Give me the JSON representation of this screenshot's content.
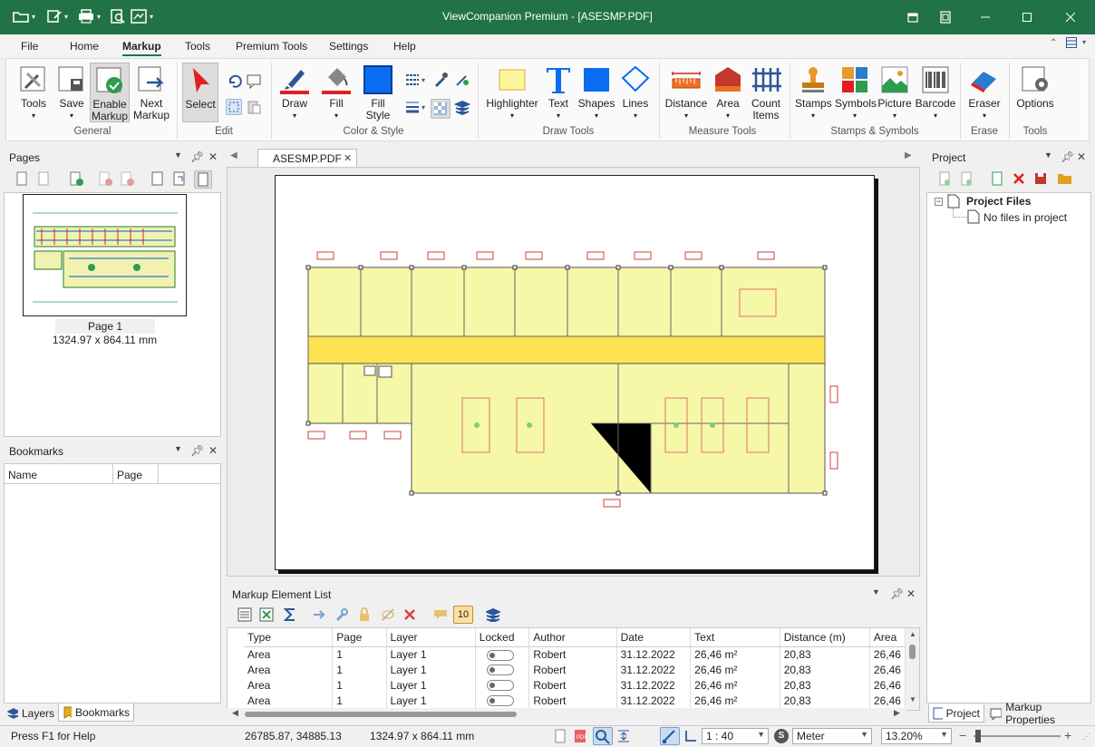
{
  "app": {
    "title": "ViewCompanion Premium - [ASESMP.PDF]",
    "accent": "#217346"
  },
  "menu": {
    "items": [
      "File",
      "Home",
      "Markup",
      "Tools",
      "Premium Tools",
      "Settings",
      "Help"
    ],
    "active": "Markup"
  },
  "ribbon": {
    "general": {
      "label": "General",
      "tools": "Tools",
      "save": "Save",
      "enable1": "Enable",
      "enable2": "Markup",
      "next1": "Next",
      "next2": "Markup"
    },
    "edit": {
      "label": "Edit",
      "select": "Select"
    },
    "color_style": {
      "label": "Color & Style",
      "draw": "Draw",
      "fill": "Fill",
      "fillstyle1": "Fill",
      "fillstyle2": "Style"
    },
    "draw_tools": {
      "label": "Draw Tools",
      "highlighter": "Highlighter",
      "text": "Text",
      "shapes": "Shapes",
      "lines": "Lines"
    },
    "measure_tools": {
      "label": "Measure Tools",
      "distance": "Distance",
      "area": "Area",
      "count1": "Count",
      "count2": "Items"
    },
    "stamps_symbols": {
      "label": "Stamps & Symbols",
      "stamps": "Stamps",
      "symbols": "Symbols",
      "picture": "Picture",
      "barcode": "Barcode"
    },
    "erase": {
      "label": "Erase",
      "eraser": "Eraser"
    },
    "tools": {
      "label": "Tools",
      "options": "Options"
    }
  },
  "pages_panel": {
    "title": "Pages",
    "page_label": "Page 1",
    "page_size": "1324.97 x 864.11 mm"
  },
  "bookmarks_panel": {
    "title": "Bookmarks",
    "col_name": "Name",
    "col_page": "Page"
  },
  "left_tabs": {
    "layers": "Layers",
    "bookmarks": "Bookmarks"
  },
  "document": {
    "tab": "ASESMP.PDF"
  },
  "project_panel": {
    "title": "Project",
    "root": "Project Files",
    "child": "No files in project"
  },
  "right_tabs": {
    "project": "Project",
    "markup_properties": "Markup Properties"
  },
  "markup_list": {
    "title": "Markup Element List",
    "badge": "10",
    "columns": [
      "Type",
      "Page",
      "Layer",
      "Locked",
      "Author",
      "Date",
      "Text",
      "Distance (m)",
      "Area"
    ],
    "rows": [
      {
        "type": "Area",
        "page": "1",
        "layer": "Layer 1",
        "author": "Robert",
        "date": "31.12.2022",
        "text": "26,46 m²",
        "distance": "20,83",
        "area": "26,46"
      },
      {
        "type": "Area",
        "page": "1",
        "layer": "Layer 1",
        "author": "Robert",
        "date": "31.12.2022",
        "text": "26,46 m²",
        "distance": "20,83",
        "area": "26,46"
      },
      {
        "type": "Area",
        "page": "1",
        "layer": "Layer 1",
        "author": "Robert",
        "date": "31.12.2022",
        "text": "26,46 m²",
        "distance": "20,83",
        "area": "26,46"
      },
      {
        "type": "Area",
        "page": "1",
        "layer": "Layer 1",
        "author": "Robert",
        "date": "31.12.2022",
        "text": "26,46 m²",
        "distance": "20,83",
        "area": "26,46"
      }
    ]
  },
  "status": {
    "help": "Press F1 for Help",
    "coords": "26785.87, 34885.13",
    "size": "1324.97 x 864.11 mm",
    "scale": "1 : 40",
    "unit": "Meter",
    "zoom": "13.20%"
  }
}
